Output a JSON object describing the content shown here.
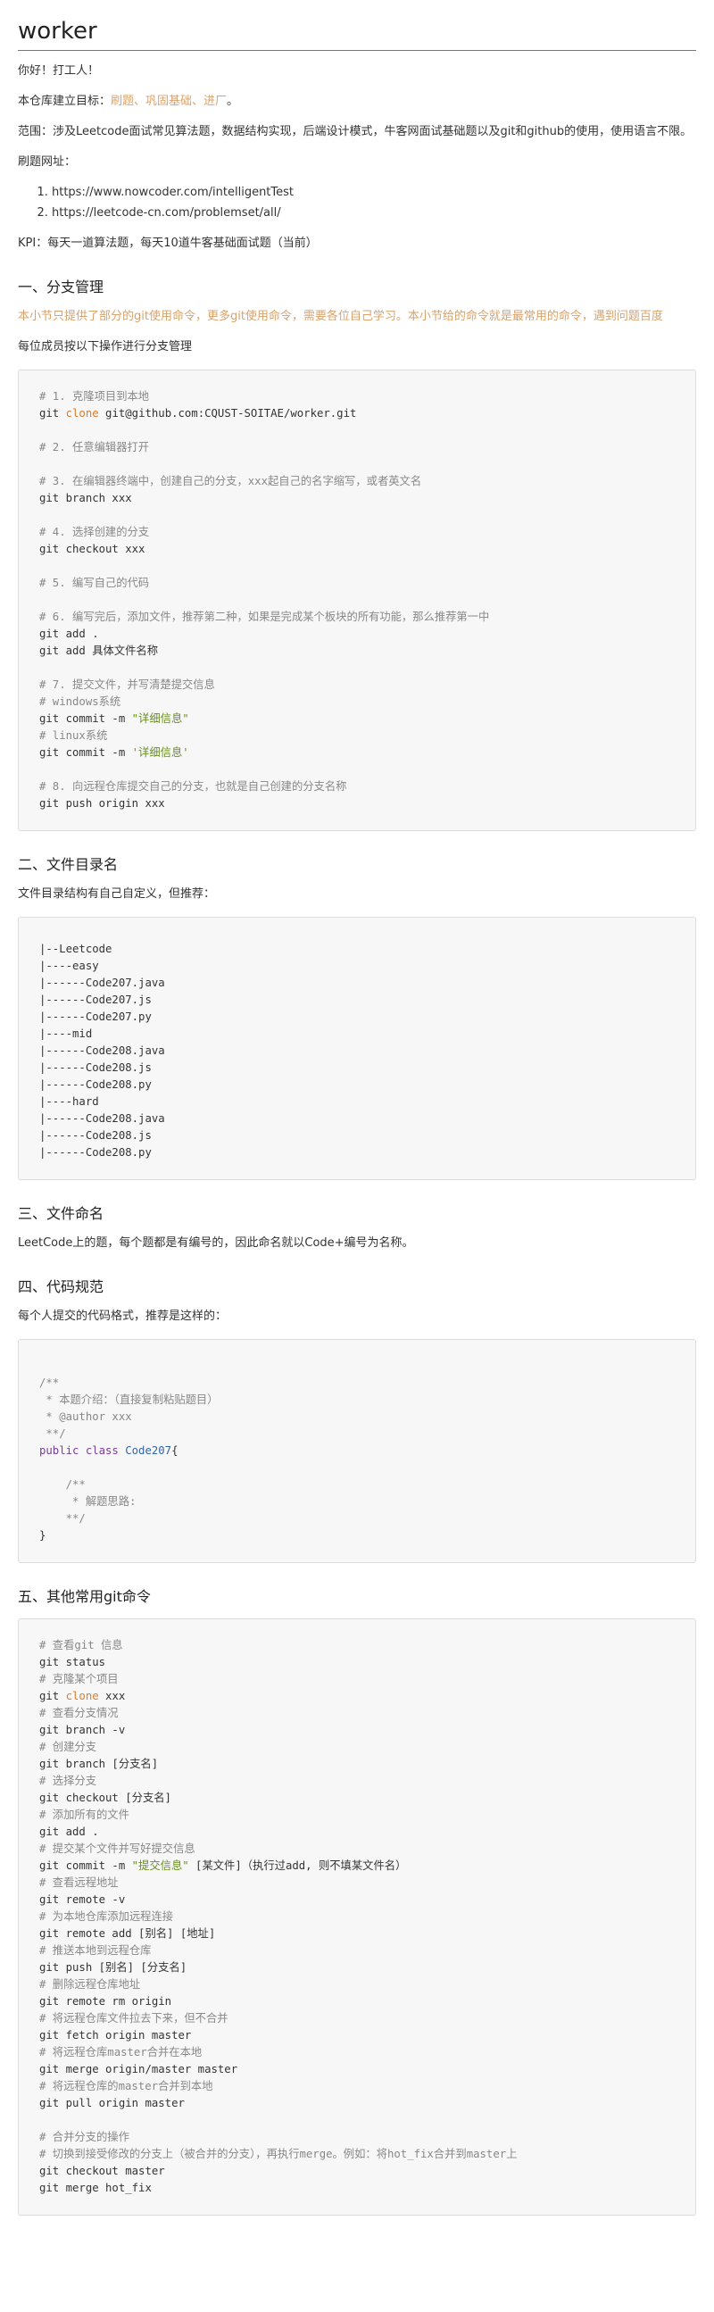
{
  "title": "worker",
  "greeting": "你好！打工人！",
  "goal_prefix": "本仓库建立目标：",
  "goal_highlight": "刷题、巩固基础、进厂",
  "goal_suffix": "。",
  "scope": "范围：涉及Leetcode面试常见算法题，数据结构实现，后端设计模式，牛客网面试基础题以及git和github的使用，使用语言不限。",
  "sites_label": "刷题网址：",
  "sites": [
    "https://www.nowcoder.com/intelligentTest",
    "https://leetcode-cn.com/problemset/all/"
  ],
  "kpi": "KPI：每天一道算法题，每天10道牛客基础面试题（当前）",
  "section1": {
    "heading": "一、分支管理",
    "note": "本小节只提供了部分的git使用命令，更多git使用命令，需要各位自己学习。本小节给的命令就是最常用的命令，遇到问题百度",
    "intro": "每位成员按以下操作进行分支管理",
    "code": [
      {
        "t": "# 1. 克隆项目到本地",
        "k": "c"
      },
      {
        "t": "git ",
        "k": "",
        "parts": [
          {
            "t": "git ",
            "k": ""
          },
          {
            "t": "clone",
            "k": "o"
          },
          {
            "t": " git@github.com:CQUST-SOITAE/worker.git",
            "k": ""
          }
        ]
      },
      {
        "t": "",
        "k": ""
      },
      {
        "t": "# 2. 任意编辑器打开",
        "k": "c"
      },
      {
        "t": "",
        "k": ""
      },
      {
        "t": "# 3. 在编辑器终端中，创建自己的分支，xxx起自己的名字缩写，或者英文名",
        "k": "c"
      },
      {
        "t": "git branch xxx",
        "k": ""
      },
      {
        "t": "",
        "k": ""
      },
      {
        "t": "# 4. 选择创建的分支",
        "k": "c"
      },
      {
        "t": "git checkout xxx",
        "k": ""
      },
      {
        "t": "",
        "k": ""
      },
      {
        "t": "# 5. 编写自己的代码",
        "k": "c"
      },
      {
        "t": "",
        "k": ""
      },
      {
        "t": "# 6. 编写完后，添加文件，推荐第二种，如果是完成某个板块的所有功能，那么推荐第一中",
        "k": "c"
      },
      {
        "t": "git add .",
        "k": ""
      },
      {
        "t": "git add 具体文件名称",
        "k": ""
      },
      {
        "t": "",
        "k": ""
      },
      {
        "t": "# 7. 提交文件，并写清楚提交信息",
        "k": "c"
      },
      {
        "t": "# windows系统",
        "k": "c"
      },
      {
        "t": "",
        "k": "",
        "parts": [
          {
            "t": "git commit -m ",
            "k": ""
          },
          {
            "t": "\"详细信息\"",
            "k": "s"
          }
        ]
      },
      {
        "t": "# linux系统",
        "k": "c"
      },
      {
        "t": "",
        "k": "",
        "parts": [
          {
            "t": "git commit -m ",
            "k": ""
          },
          {
            "t": "'详细信息'",
            "k": "s"
          }
        ]
      },
      {
        "t": "",
        "k": ""
      },
      {
        "t": "# 8. 向远程仓库提交自己的分支，也就是自己创建的分支名称",
        "k": "c"
      },
      {
        "t": "git push origin xxx",
        "k": ""
      }
    ]
  },
  "section2": {
    "heading": "二、文件目录名",
    "intro": "文件目录结构有自己自定义，但推荐：",
    "code": [
      {
        "t": "|--Leetcode",
        "k": ""
      },
      {
        "t": "|----easy",
        "k": ""
      },
      {
        "t": "|------Code207.java",
        "k": ""
      },
      {
        "t": "|------Code207.js",
        "k": ""
      },
      {
        "t": "|------Code207.py",
        "k": ""
      },
      {
        "t": "|----mid",
        "k": ""
      },
      {
        "t": "|------Code208.java",
        "k": ""
      },
      {
        "t": "|------Code208.js",
        "k": ""
      },
      {
        "t": "|------Code208.py",
        "k": ""
      },
      {
        "t": "|----hard",
        "k": ""
      },
      {
        "t": "|------Code208.java",
        "k": ""
      },
      {
        "t": "|------Code208.js",
        "k": ""
      },
      {
        "t": "|------Code208.py",
        "k": ""
      }
    ]
  },
  "section3": {
    "heading": "三、文件命名",
    "text": "LeetCode上的题，每个题都是有编号的，因此命名就以Code+编号为名称。"
  },
  "section4": {
    "heading": "四、代码规范",
    "intro": "每个人提交的代码格式，推荐是这样的：",
    "code": [
      {
        "t": "",
        "k": ""
      },
      {
        "t": "/**",
        "k": "c"
      },
      {
        "t": " * 本题介绍：（直接复制粘贴题目）",
        "k": "c"
      },
      {
        "t": " * @author xxx",
        "k": "c"
      },
      {
        "t": " **/",
        "k": "c"
      },
      {
        "t": "",
        "k": "",
        "parts": [
          {
            "t": "public class ",
            "k": "k"
          },
          {
            "t": "Code207",
            "k": "cl"
          },
          {
            "t": "{",
            "k": ""
          }
        ]
      },
      {
        "t": "",
        "k": ""
      },
      {
        "t": "    /**",
        "k": "c"
      },
      {
        "t": "     * 解题思路:",
        "k": "c"
      },
      {
        "t": "    **/",
        "k": "c"
      },
      {
        "t": "}",
        "k": ""
      }
    ]
  },
  "section5": {
    "heading": "五、其他常用git命令",
    "code": [
      {
        "t": "# 查看git 信息",
        "k": "c"
      },
      {
        "t": "git status",
        "k": ""
      },
      {
        "t": "# 克隆某个项目",
        "k": "c"
      },
      {
        "t": "",
        "k": "",
        "parts": [
          {
            "t": "git ",
            "k": ""
          },
          {
            "t": "clone",
            "k": "o"
          },
          {
            "t": " xxx",
            "k": ""
          }
        ]
      },
      {
        "t": "# 查看分支情况",
        "k": "c"
      },
      {
        "t": "git branch -v",
        "k": ""
      },
      {
        "t": "# 创建分支",
        "k": "c"
      },
      {
        "t": "git branch [分支名]",
        "k": ""
      },
      {
        "t": "# 选择分支",
        "k": "c"
      },
      {
        "t": "git checkout [分支名]",
        "k": ""
      },
      {
        "t": "# 添加所有的文件",
        "k": "c"
      },
      {
        "t": "git add .",
        "k": ""
      },
      {
        "t": "# 提交某个文件并写好提交信息",
        "k": "c"
      },
      {
        "t": "",
        "k": "",
        "parts": [
          {
            "t": "git commit -m ",
            "k": ""
          },
          {
            "t": "\"提交信息\"",
            "k": "s"
          },
          {
            "t": " [某文件]（执行过add, 则不填某文件名）",
            "k": ""
          }
        ]
      },
      {
        "t": "# 查看远程地址",
        "k": "c"
      },
      {
        "t": "git remote -v",
        "k": ""
      },
      {
        "t": "# 为本地仓库添加远程连接",
        "k": "c"
      },
      {
        "t": "git remote add [别名] [地址]",
        "k": ""
      },
      {
        "t": "# 推送本地到远程仓库",
        "k": "c"
      },
      {
        "t": "git push [别名] [分支名]",
        "k": ""
      },
      {
        "t": "# 删除远程仓库地址",
        "k": "c"
      },
      {
        "t": "git remote rm origin",
        "k": ""
      },
      {
        "t": "# 将远程仓库文件拉去下来，但不合并",
        "k": "c"
      },
      {
        "t": "git fetch origin master",
        "k": ""
      },
      {
        "t": "# 将远程仓库master合并在本地",
        "k": "c"
      },
      {
        "t": "git merge origin/master master",
        "k": ""
      },
      {
        "t": "# 将远程仓库的master合并到本地",
        "k": "c"
      },
      {
        "t": "git pull origin master",
        "k": ""
      },
      {
        "t": "",
        "k": ""
      },
      {
        "t": "# 合并分支的操作",
        "k": "c"
      },
      {
        "t": "# 切换到接受修改的分支上（被合并的分支），再执行merge。例如：将hot_fix合并到master上",
        "k": "c"
      },
      {
        "t": "git checkout master",
        "k": ""
      },
      {
        "t": "git merge hot_fix",
        "k": ""
      }
    ]
  }
}
